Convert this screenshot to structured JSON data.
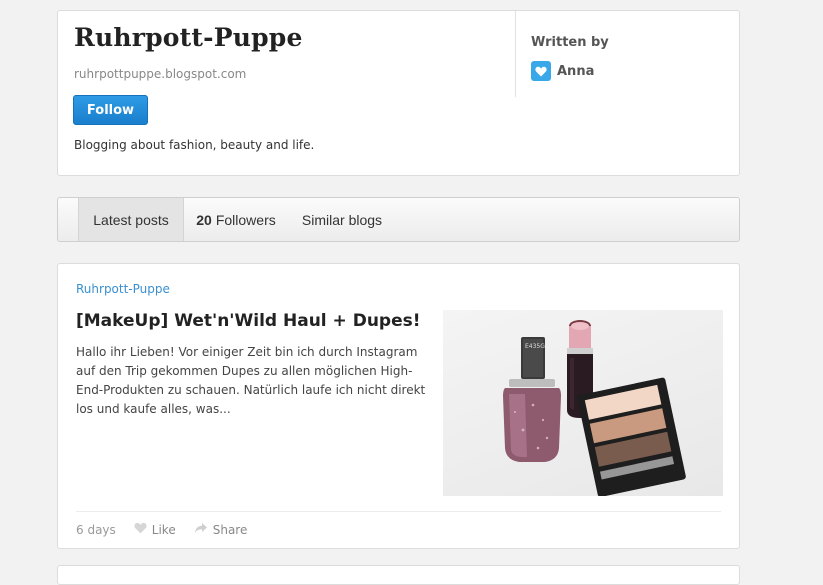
{
  "blog": {
    "title": "Ruhrpott-Puppe",
    "url": "ruhrpottpuppe.blogspot.com",
    "follow_label": "Follow",
    "description": "Blogging about fashion, beauty and life.",
    "written_by_label": "Written by",
    "author_name": "Anna"
  },
  "tabs": {
    "latest": "Latest posts",
    "followers_count": "20",
    "followers_label": "Followers",
    "similar": "Similar blogs"
  },
  "post": {
    "source": "Ruhrpott-Puppe",
    "title": "[MakeUp] Wet'n'Wild Haul + Dupes!",
    "excerpt": "Hallo ihr Lieben! Vor einiger Zeit bin ich durch Instagram auf den Trip gekommen Dupes zu allen möglichen High-End-Produkten zu schauen. Natürlich laufe ich nicht direkt los und kaufe alles, was...",
    "age": "6 days",
    "like_label": "Like",
    "share_label": "Share",
    "polish_label": "E435G"
  },
  "colors": {
    "accent": "#1a7fcc",
    "link": "#3b8fd0",
    "heart_badge": "#39a8e8"
  }
}
